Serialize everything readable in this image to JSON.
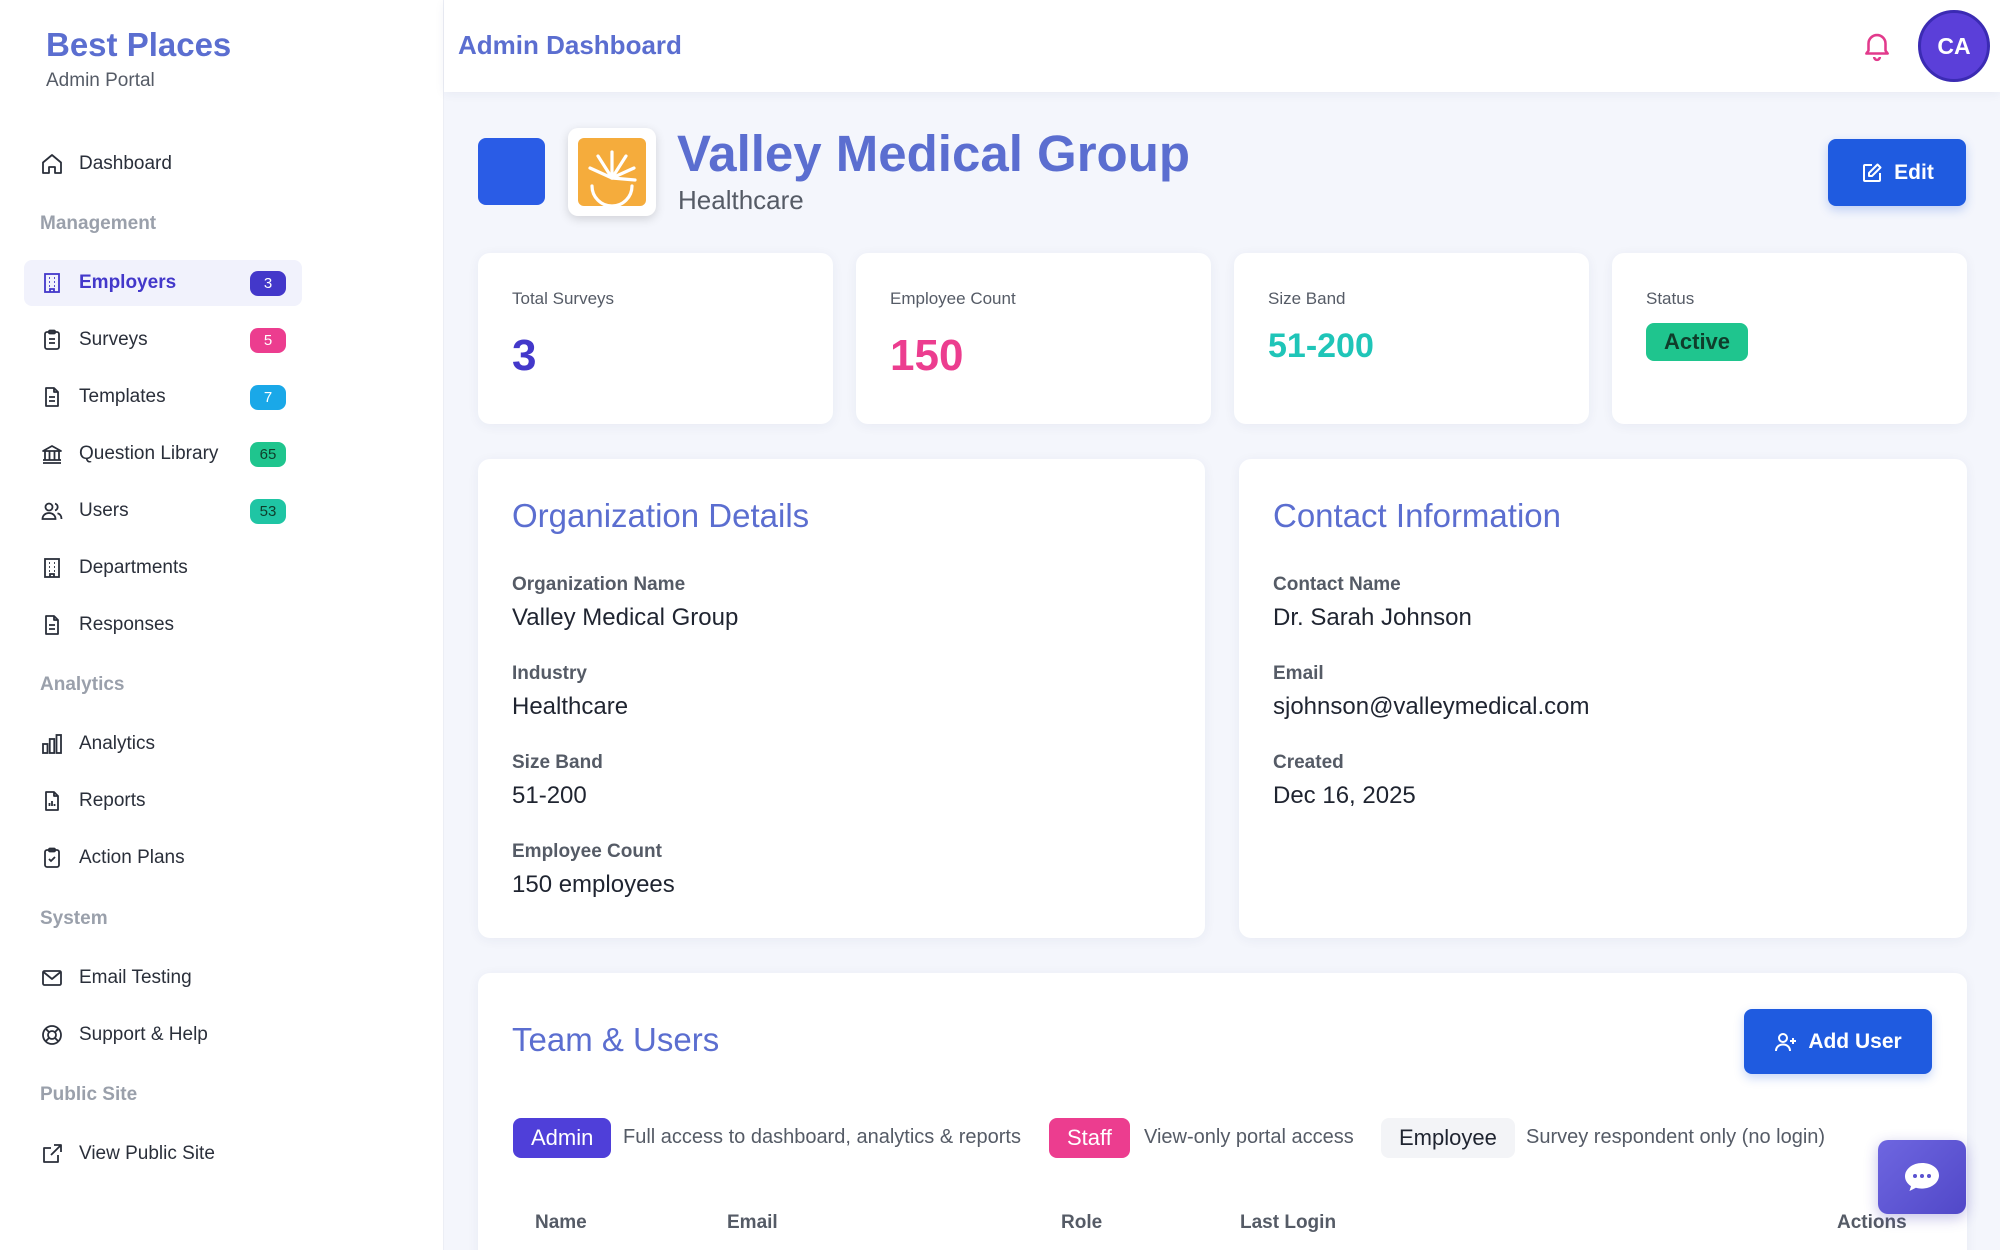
{
  "brand": {
    "title": "Best Places",
    "subtitle": "Admin Portal"
  },
  "sidebar": {
    "dashboard": {
      "label": "Dashboard",
      "icon": "home-icon"
    },
    "sections": {
      "management": "Management",
      "analytics": "Analytics",
      "system": "System",
      "public": "Public Site"
    },
    "management_items": [
      {
        "label": "Employers",
        "icon": "building-icon",
        "badge": "3",
        "badge_color": "#4338ca",
        "active": true
      },
      {
        "label": "Surveys",
        "icon": "clipboard-icon",
        "badge": "5",
        "badge_color": "#ec3d8f"
      },
      {
        "label": "Templates",
        "icon": "file-icon",
        "badge": "7",
        "badge_color": "#1aa8e8"
      },
      {
        "label": "Question Library",
        "icon": "library-icon",
        "badge": "65",
        "badge_color": "#1fc58e"
      },
      {
        "label": "Users",
        "icon": "users-icon",
        "badge": "53",
        "badge_color": "#1fc5a4"
      },
      {
        "label": "Departments",
        "icon": "building-icon"
      },
      {
        "label": "Responses",
        "icon": "file-icon"
      }
    ],
    "analytics_items": [
      {
        "label": "Analytics",
        "icon": "bar-chart-icon"
      },
      {
        "label": "Reports",
        "icon": "report-icon"
      },
      {
        "label": "Action Plans",
        "icon": "clipboard-check-icon"
      }
    ],
    "system_items": [
      {
        "label": "Email Testing",
        "icon": "mail-icon"
      },
      {
        "label": "Support & Help",
        "icon": "lifebuoy-icon"
      }
    ],
    "public_items": [
      {
        "label": "View Public Site",
        "icon": "external-link-icon"
      }
    ]
  },
  "topbar": {
    "title": "Admin Dashboard",
    "avatar_initials": "CA"
  },
  "header": {
    "org_name": "Valley Medical Group",
    "industry": "Healthcare",
    "edit_label": "Edit"
  },
  "stats": [
    {
      "label": "Total Surveys",
      "value": "3",
      "color": "#4338ca"
    },
    {
      "label": "Employee Count",
      "value": "150",
      "color": "#ec3d8f"
    },
    {
      "label": "Size Band",
      "value": "51-200",
      "color": "#1fc5b8"
    },
    {
      "label": "Status",
      "value": "Active"
    }
  ],
  "org_details": {
    "title": "Organization Details",
    "fields": [
      {
        "label": "Organization Name",
        "value": "Valley Medical Group"
      },
      {
        "label": "Industry",
        "value": "Healthcare"
      },
      {
        "label": "Size Band",
        "value": "51-200"
      },
      {
        "label": "Employee Count",
        "value": "150 employees"
      }
    ]
  },
  "contact": {
    "title": "Contact Information",
    "fields": [
      {
        "label": "Contact Name",
        "value": "Dr. Sarah Johnson"
      },
      {
        "label": "Email",
        "value": "sjohnson@valleymedical.com"
      },
      {
        "label": "Created",
        "value": "Dec 16, 2025"
      }
    ]
  },
  "team": {
    "title": "Team & Users",
    "add_user_label": "Add User",
    "roles": [
      {
        "name": "Admin",
        "desc": "Full access to dashboard, analytics & reports"
      },
      {
        "name": "Staff",
        "desc": "View-only portal access"
      },
      {
        "name": "Employee",
        "desc": "Survey respondent only (no login)"
      }
    ],
    "columns": [
      "Name",
      "Email",
      "Role",
      "Last Login",
      "Actions"
    ]
  }
}
